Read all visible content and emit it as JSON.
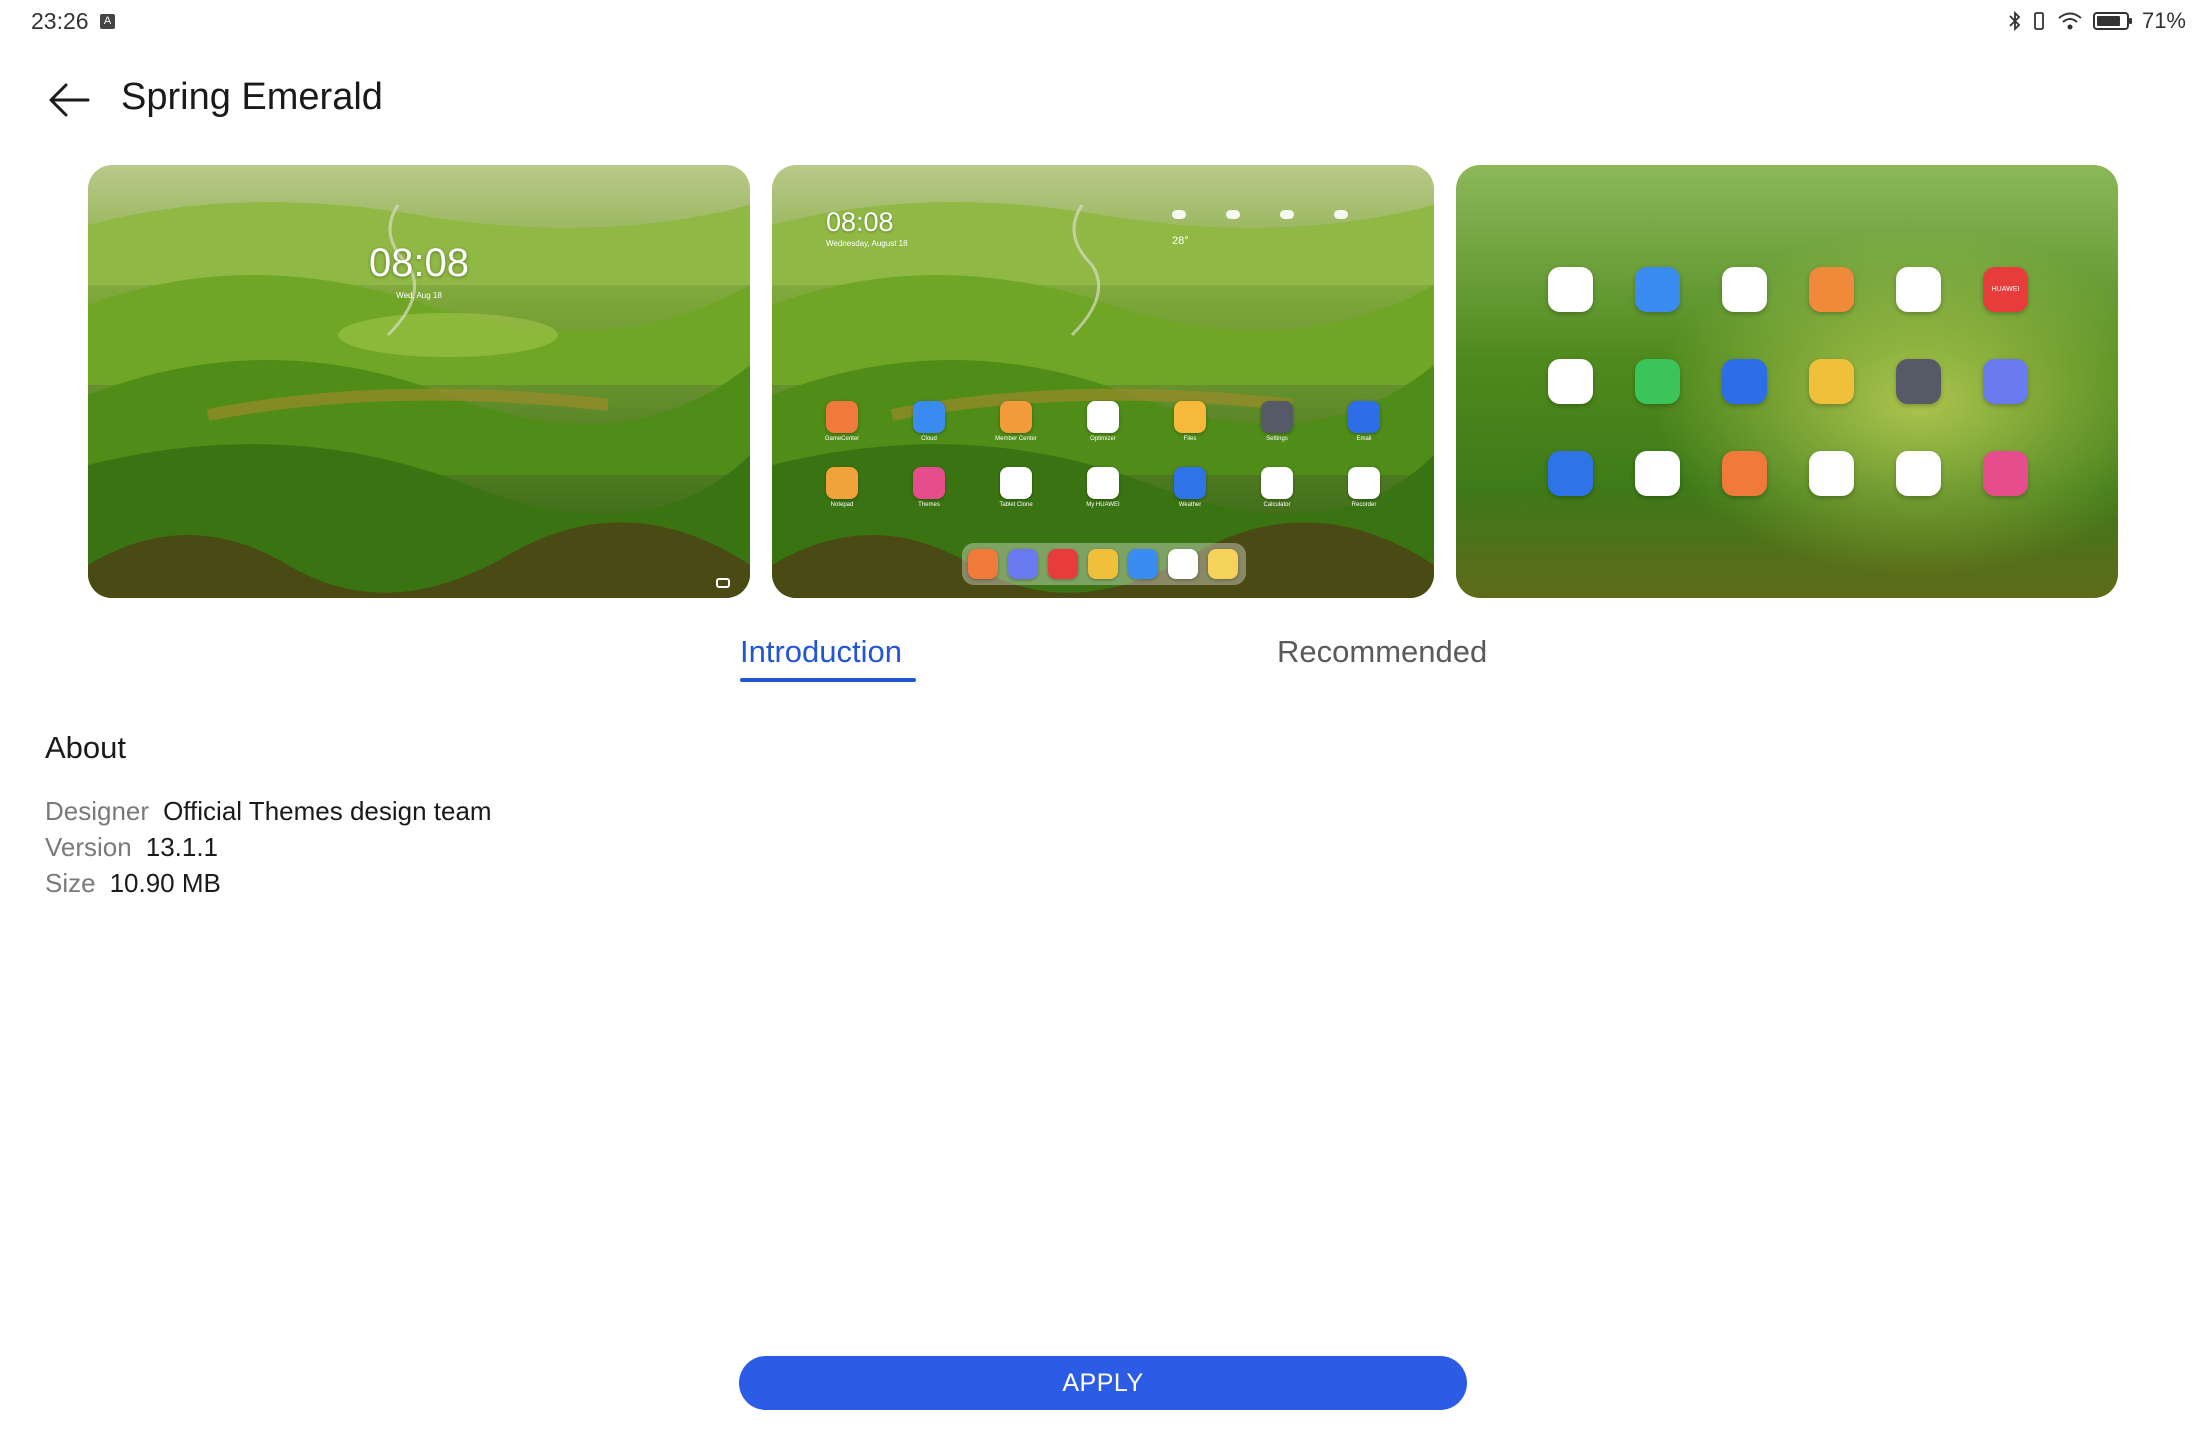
{
  "status_bar": {
    "time": "23:26",
    "notification_icon": "a-notification-icon",
    "icons": [
      "bluetooth-icon",
      "vibrate-icon",
      "wifi-icon",
      "battery-icon"
    ],
    "battery": "71%"
  },
  "header": {
    "back_icon": "back-arrow-icon",
    "title": "Spring Emerald"
  },
  "previews": {
    "lock_screen": {
      "time": "08:08",
      "date": "Wed, Aug 18"
    },
    "home_screen": {
      "time": "08:08",
      "date": "Wednesday, August 18",
      "temperature": "28°",
      "row1_labels": [
        "GameCenter",
        "Cloud",
        "Member Center",
        "Optimizer",
        "Files",
        "Settings",
        "Email"
      ],
      "row2_labels": [
        "Notepad",
        "Themes",
        "Tablet Clone",
        "My HUAWEI",
        "Weather",
        "Calculator",
        "Recorder"
      ]
    },
    "icons_screen": {
      "huawei_label": "HUAWEI"
    }
  },
  "tabs": [
    {
      "label": "Introduction",
      "active": true
    },
    {
      "label": "Recommended",
      "active": false
    }
  ],
  "about": {
    "title": "About",
    "designer_label": "Designer",
    "designer_value": "Official Themes design team",
    "version_label": "Version",
    "version_value": "13.1.1",
    "size_label": "Size",
    "size_value": "10.90 MB"
  },
  "apply_label": "APPLY",
  "colors": {
    "accent": "#2356d6",
    "apply_button": "#2c5ce6"
  }
}
